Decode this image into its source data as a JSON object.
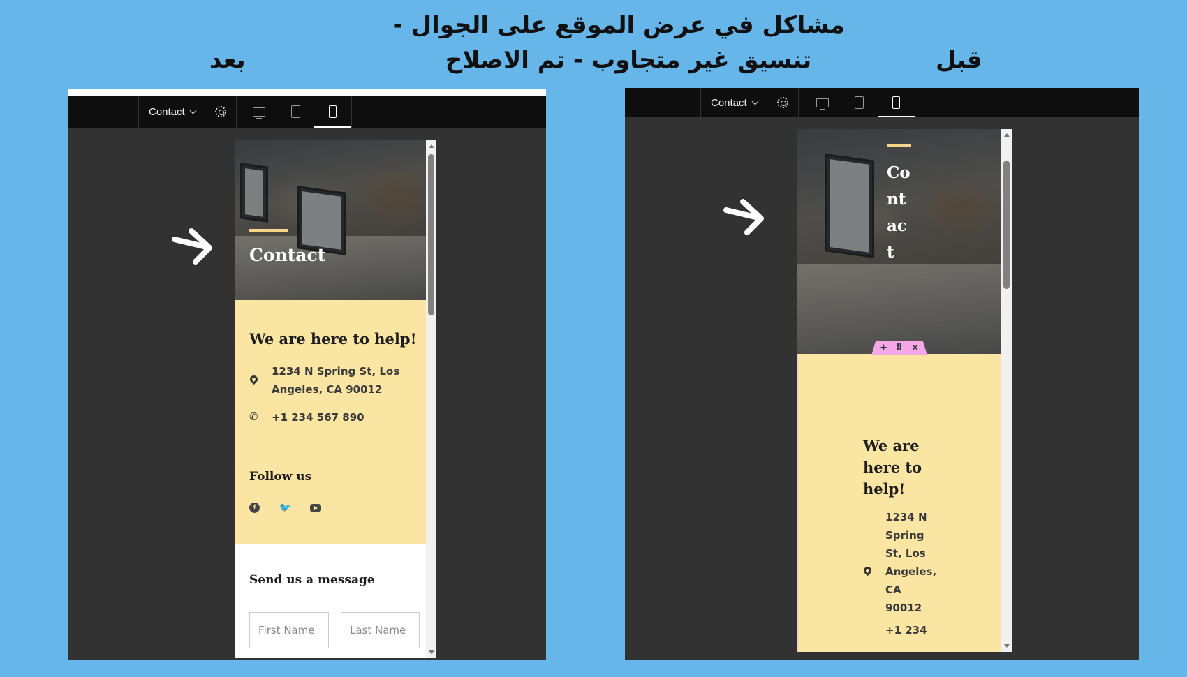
{
  "header": {
    "title_line1": "مشاكل في عرض الموقع على الجوال -",
    "title_line2": "تنسيق غير متجاوب - تم الاصلاح",
    "label_after": "بعد",
    "label_before": "قبل"
  },
  "toolbar": {
    "page_select": "Contact",
    "settings_icon": "gear-icon",
    "devices": [
      "desktop-icon",
      "tablet-icon",
      "mobile-icon"
    ],
    "active_device": "mobile"
  },
  "after": {
    "hero_title": "Contact",
    "help_heading": "We are here to help!",
    "address_line1": "1234 N Spring St, Los",
    "address_line2": "Angeles, CA 90012",
    "phone": "+1 234 567 890",
    "follow_heading": "Follow us",
    "social": [
      "facebook-icon",
      "twitter-icon",
      "youtube-icon"
    ],
    "message_heading": "Send us a message",
    "first_name_placeholder": "First Name",
    "last_name_placeholder": "Last Name"
  },
  "before": {
    "hero_title_lines": [
      "Co",
      "nt",
      "ac",
      "t"
    ],
    "help_heading_lines": [
      "We are",
      "here to",
      "help!"
    ],
    "address_lines": [
      "1234 N",
      "Spring",
      "St, Los",
      "Angeles,",
      "CA",
      "90012"
    ],
    "phone_partial": "+1 234",
    "section_handle": [
      "+",
      "⠿",
      "×"
    ]
  },
  "colors": {
    "background": "#66b6ea",
    "editor_dark": "#323232",
    "toolbar": "#0e0e0e",
    "contact_panel": "#fbe5a3",
    "accent_bar": "#f7d68a",
    "section_handle": "#f5a8e8"
  }
}
